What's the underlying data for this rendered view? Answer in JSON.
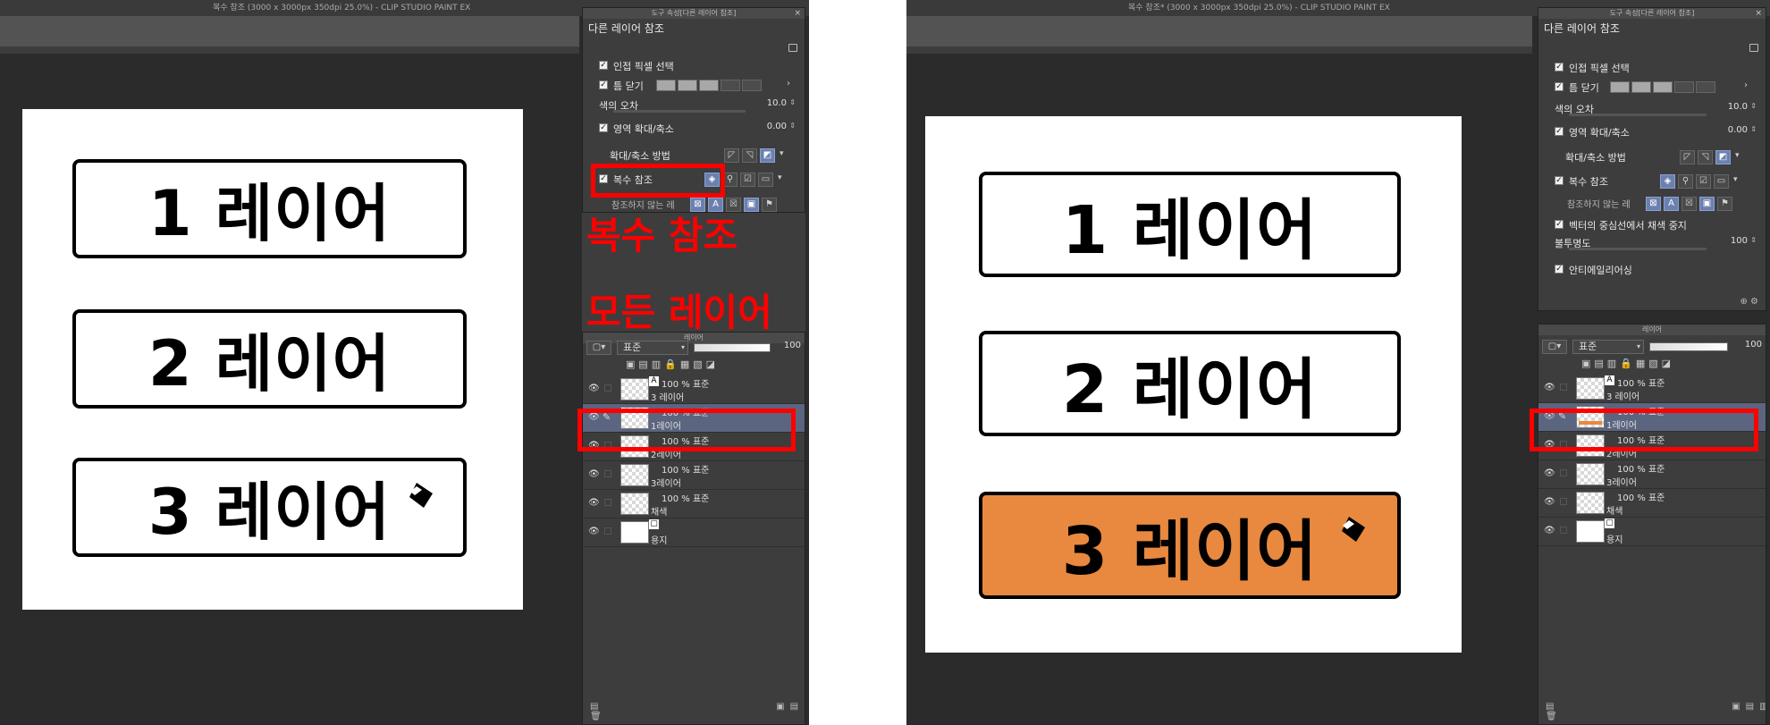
{
  "left": {
    "title": "복수 참조 (3000 x 3000px 350dpi 25.0%)  - CLIP STUDIO PAINT EX",
    "labels": [
      "1 레이어",
      "2 레이어",
      "3 레이어"
    ],
    "tool_panel": {
      "header": "도구 속성[다른 레이어 참조]",
      "close": "×",
      "title": "다른 레이어 참조",
      "adjacent": "인접 픽셀 선택",
      "gap_close": "틈 닫기",
      "tolerance_label": "색의 오차",
      "tolerance_value": "10.0",
      "area_scale": "영역 확대/축소",
      "area_value": "0.00",
      "scale_method": "확대/축소 방법",
      "multi_ref": "복수 참조",
      "no_ref": "참조하지 않는 레"
    },
    "layer_panel": {
      "header": "레이어",
      "blend": "표준",
      "opacity": "100",
      "layers": [
        {
          "mode": "100 % 표준",
          "name": "3 레이어"
        },
        {
          "mode": "100 % 표준",
          "name": "1레이어"
        },
        {
          "mode": "100 % 표준",
          "name": "2레이어"
        },
        {
          "mode": "100 % 표준",
          "name": "3레이어"
        },
        {
          "mode": "100 % 표준",
          "name": "채색"
        },
        {
          "mode": "",
          "name": "용지"
        }
      ]
    },
    "annotation_multi": "복수 참조",
    "annotation_all": "모든 레이어"
  },
  "right": {
    "title": "복수 참조* (3000 x 3000px 350dpi 25.0%)  - CLIP STUDIO PAINT EX",
    "labels": [
      "1 레이어",
      "2 레이어",
      "3 레이어"
    ],
    "tool_panel": {
      "header": "도구 속성[다른 레이어 참조]",
      "close": "×",
      "title": "다른 레이어 참조",
      "adjacent": "인접 픽셀 선택",
      "gap_close": "틈 닫기",
      "tolerance_label": "색의 오차",
      "tolerance_value": "10.0",
      "area_scale": "영역 확대/축소",
      "area_value": "0.00",
      "scale_method": "확대/축소 방법",
      "multi_ref": "복수 참조",
      "no_ref": "참조하지 않는 레",
      "vector_stop": "벡터의 중심선에서 채색 중지",
      "opacity_label": "불투명도",
      "opacity_value": "100",
      "antialias": "안티에일리어싱"
    },
    "layer_panel": {
      "header": "레이어",
      "blend": "표준",
      "opacity": "100",
      "layers": [
        {
          "mode": "100 % 표준",
          "name": "3 레이어"
        },
        {
          "mode": "100 % 표준",
          "name": "1레이어"
        },
        {
          "mode": "100 % 표준",
          "name": "2레이어"
        },
        {
          "mode": "100 % 표준",
          "name": "3레이어"
        },
        {
          "mode": "100 % 표준",
          "name": "채색"
        },
        {
          "mode": "",
          "name": "용지"
        }
      ]
    }
  },
  "colors": {
    "app_bg": "#2b2b2b",
    "annotation_red": "#ff0000",
    "orange_fill": "#e8893f",
    "selected_layer": "#5b6580"
  },
  "icons": {
    "eye": "eye-icon",
    "pen": "pen-icon",
    "fill": "fill-bucket-icon"
  }
}
